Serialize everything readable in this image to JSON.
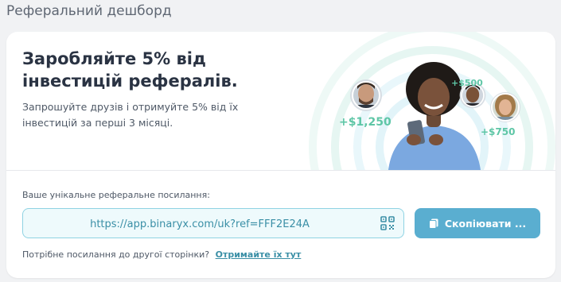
{
  "page": {
    "title": "Реферальний дешборд"
  },
  "hero": {
    "title_line1": "Заробляйте 5% від",
    "title_line2": "інвестицій рефералів.",
    "description_line1": "Запрошуйте друзів і отримуйте 5% від їх",
    "description_line2": "інвестицій за перші 3 місяці.",
    "amounts": [
      "+$1,250",
      "+$500",
      "+$750"
    ]
  },
  "referral": {
    "label": "Ваше унікальне реферальне посилання:",
    "link": "https://app.binaryx.com/uk?ref=FFF2E24A",
    "copy_label": "Скопіювати ...",
    "other_page_text": "Потрібне посилання до другої сторінки?",
    "other_page_link": "Отримайте їх тут"
  },
  "colors": {
    "accent": "#5aaed0",
    "field_border": "#8fd3e3",
    "field_bg": "#eefafc",
    "amount_green": "#5ec6a6",
    "page_bg": "#f1f2f4"
  },
  "icons": [
    "qr-code-icon",
    "copy-icon"
  ]
}
